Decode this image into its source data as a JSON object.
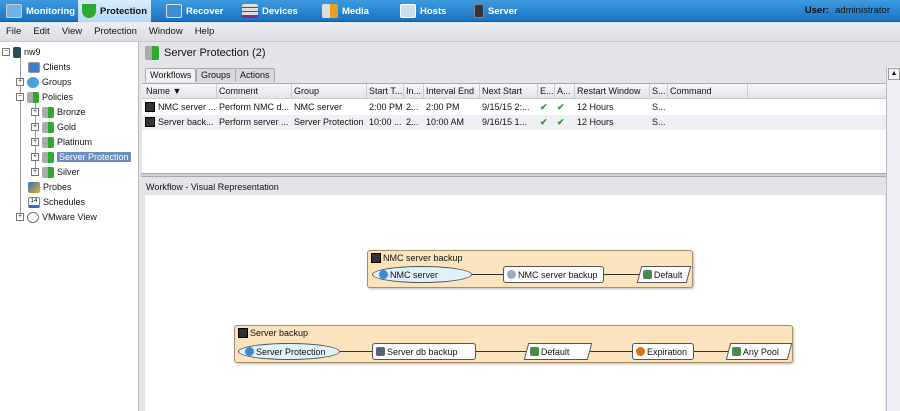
{
  "topnav": {
    "items": [
      {
        "label": "Monitoring",
        "icon": "monitor-icon",
        "active": false
      },
      {
        "label": "Protection",
        "icon": "shield-icon",
        "active": true
      },
      {
        "label": "Recover",
        "icon": "recover-icon",
        "active": false
      },
      {
        "label": "Devices",
        "icon": "devices-icon",
        "active": false
      },
      {
        "label": "Media",
        "icon": "media-icon",
        "active": false
      },
      {
        "label": "Hosts",
        "icon": "hosts-icon",
        "active": false
      },
      {
        "label": "Server",
        "icon": "server-icon",
        "active": false
      }
    ],
    "user_label": "User:",
    "user_value": "administrator"
  },
  "menubar": [
    "File",
    "Edit",
    "View",
    "Protection",
    "Window",
    "Help"
  ],
  "tree": {
    "root": "nw9",
    "items": [
      "Clients",
      "Groups",
      "Policies",
      "Bronze",
      "Gold",
      "Platinum",
      "Server Protection",
      "Silver",
      "Probes",
      "Schedules",
      "VMware View"
    ],
    "schedules_icon_text": "14",
    "selected": "Server Protection"
  },
  "panel": {
    "title": "Server Protection (2)",
    "tabs": [
      "Workflows",
      "Groups",
      "Actions"
    ],
    "active_tab": "Workflows"
  },
  "table": {
    "columns": [
      "Name ▼",
      "Comment",
      "Group",
      "Start T...",
      "In...",
      "Interval End",
      "Next Start",
      "E...",
      "A...",
      "Restart Window",
      "S...",
      "Command"
    ],
    "rows": [
      [
        "NMC server ...",
        "Perform NMC d...",
        "NMC server",
        "2:00 PM",
        "2...",
        "2:00 PM",
        "9/15/15 2:...",
        "✔",
        "✔",
        "12 Hours",
        "S...",
        ""
      ],
      [
        "Server back...",
        "Perform server ...",
        "Server Protection",
        "10:00 ...",
        "2...",
        "10:00 AM",
        "9/16/15 1...",
        "✔",
        "✔",
        "12 Hours",
        "S...",
        ""
      ]
    ]
  },
  "visual": {
    "label": "Workflow - Visual Representation",
    "workflows": [
      {
        "title": "NMC server backup",
        "nodes": [
          "NMC server",
          "NMC server backup",
          "Default"
        ]
      },
      {
        "title": "Server backup",
        "nodes": [
          "Server Protection",
          "Server db backup",
          "Default",
          "Expiration",
          "Any Pool"
        ]
      }
    ]
  },
  "colors": {
    "nav_blue": "#1a72c2",
    "selection": "#6c8ebf",
    "workflow_box": "#fbe3bd",
    "check_green": "#2aa02a"
  }
}
